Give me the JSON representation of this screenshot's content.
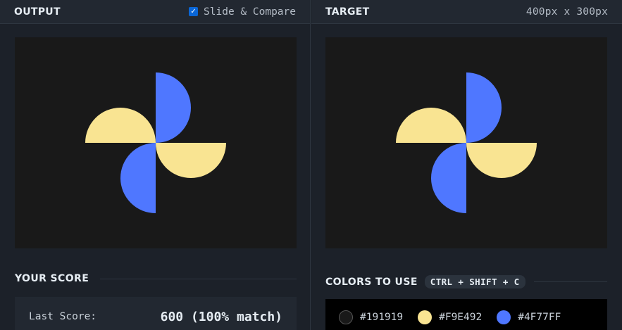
{
  "output": {
    "title": "OUTPUT",
    "slide_compare_label": "Slide & Compare",
    "slide_compare_checked": true
  },
  "target": {
    "title": "TARGET",
    "dimensions": "400px x 300px"
  },
  "score": {
    "title": "YOUR SCORE",
    "last_score_label": "Last Score:",
    "last_score_value": "600 (100% match)"
  },
  "colors": {
    "title": "COLORS TO USE",
    "shortcut": "CTRL + SHIFT + C",
    "swatches": [
      {
        "hex": "#191919",
        "color": "#191919"
      },
      {
        "hex": "#F9E492",
        "color": "#F9E492"
      },
      {
        "hex": "#4F77FF",
        "color": "#4F77FF"
      }
    ]
  },
  "shape_colors": {
    "background": "#191919",
    "yellow": "#F9E492",
    "blue": "#4F77FF"
  }
}
